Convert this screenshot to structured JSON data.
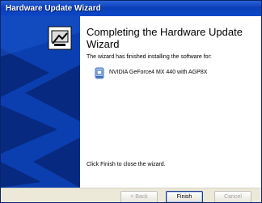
{
  "window": {
    "title": "Hardware Update Wizard"
  },
  "main": {
    "heading": "Completing the Hardware Update Wizard",
    "line1": "The wizard has finished installing the software for:",
    "device_name": "NVIDIA GeForce4 MX 440 with AGP8X",
    "finish_hint": "Click Finish to close the wizard."
  },
  "buttons": {
    "back": "< Back",
    "finish": "Finish",
    "cancel": "Cancel"
  },
  "icons": {
    "side": "wizard-hardware-icon",
    "device": "display-adapter-icon"
  },
  "colors": {
    "side_panel": "#0b3fb0",
    "title_bar": "#0d47c7"
  }
}
